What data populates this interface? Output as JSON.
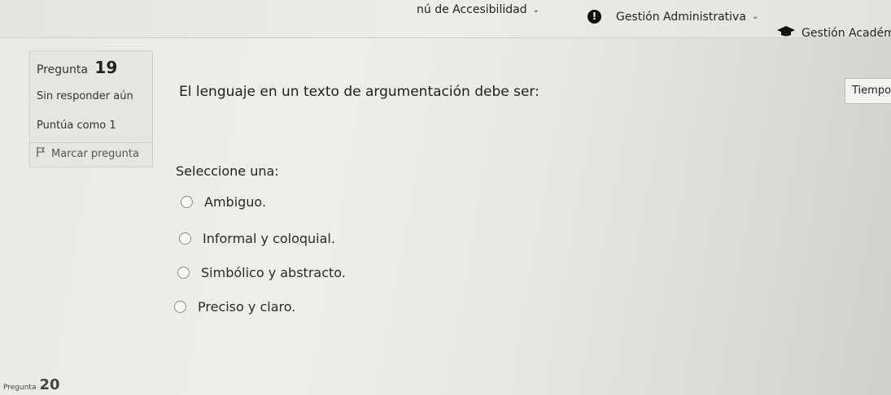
{
  "navbar": {
    "accessibility": "nú de Accesibilidad",
    "admin": "Gestión Administrativa",
    "academic": "Gestión Académi"
  },
  "question": {
    "label": "Pregunta",
    "number": "19",
    "status": "Sin responder aún",
    "grade": "Puntúa como 1",
    "flag": "Marcar pregunta",
    "text": "El lenguaje en un texto de argumentación debe ser:",
    "prompt": "Seleccione una:",
    "options": [
      "Ambiguo.",
      "Informal y coloquial.",
      "Simbólico y abstracto.",
      "Preciso y claro."
    ]
  },
  "timer": {
    "label": "Tiempo"
  },
  "next": {
    "label": "Pregunta",
    "number": "20"
  }
}
